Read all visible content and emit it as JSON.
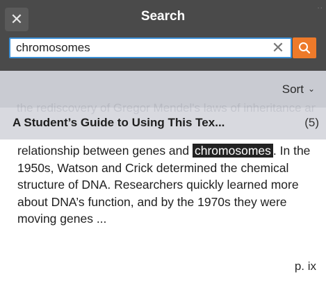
{
  "header": {
    "title": "Search",
    "close_symbol": "✕"
  },
  "search": {
    "value": "chromosomes",
    "clear_symbol": "✕"
  },
  "sort": {
    "label": "Sort",
    "chevron": "⌄"
  },
  "ghost": {
    "line": "the rediscovery of Gregor Mendel's laws of inheritance and with studies that revealed the"
  },
  "result": {
    "title": "A Student’s Guide to Using This Tex...",
    "count": "(5)",
    "snippet_before": "relationship between genes and ",
    "snippet_highlight": "chromosomes",
    "snippet_after": ". In the 1950s, Watson and Crick determined the chemical structure of DNA. Researchers quickly learned more about DNA’s function, and by the 1970s they were moving genes ...",
    "page": "p. ix"
  },
  "colors": {
    "header_bg": "#4a4a4a",
    "accent_orange": "#ee7a2a",
    "focus_blue": "#3b8fd6",
    "sort_bg": "#c9cbd2",
    "highlight_bg": "#222222"
  }
}
